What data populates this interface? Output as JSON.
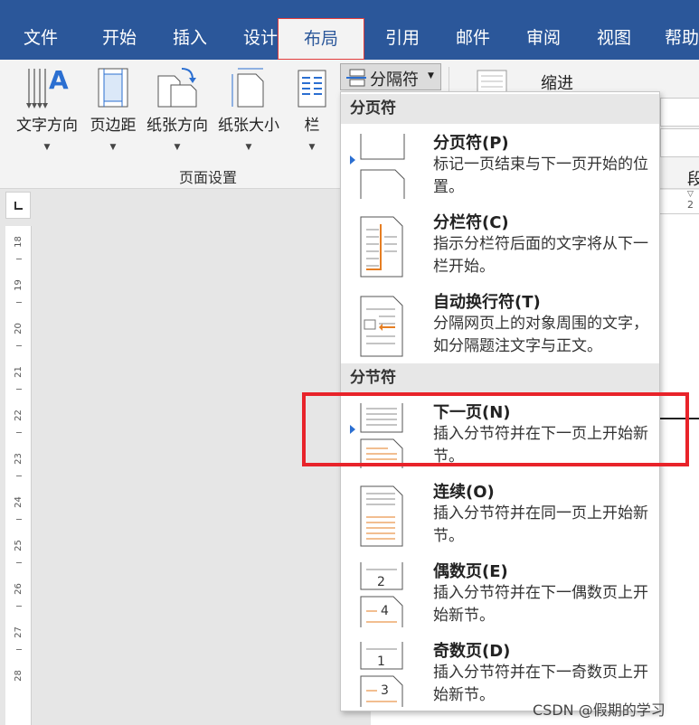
{
  "tabs": [
    "文件",
    "开始",
    "插入",
    "设计",
    "布局",
    "引用",
    "邮件",
    "审阅",
    "视图",
    "帮助"
  ],
  "active_tab_index": 4,
  "ribbon": {
    "buttons": [
      "文字方向",
      "页边距",
      "纸张方向",
      "纸张大小",
      "栏"
    ],
    "group_label": "页面设置",
    "breaks_button": "分隔符",
    "indent_label": "缩进",
    "right_label": "段"
  },
  "dropdown": {
    "page_breaks_header": "分页符",
    "section_breaks_header": "分节符",
    "items": [
      {
        "title": "分页符(P)",
        "desc": "标记一页结束与下一页开始的位置。"
      },
      {
        "title": "分栏符(C)",
        "desc": "指示分栏符后面的文字将从下一栏开始。"
      },
      {
        "title": "自动换行符(T)",
        "desc": "分隔网页上的对象周围的文字，如分隔题注文字与正文。"
      },
      {
        "title": "下一页(N)",
        "desc": "插入分节符并在下一页上开始新节。"
      },
      {
        "title": "连续(O)",
        "desc": "插入分节符并在同一页上开始新节。"
      },
      {
        "title": "偶数页(E)",
        "desc": "插入分节符并在下一偶数页上开始新节。"
      },
      {
        "title": "奇数页(D)",
        "desc": "插入分节符并在下一奇数页上开始新节。"
      }
    ]
  },
  "ruler_numbers": [
    "18",
    "19",
    "20",
    "21",
    "22",
    "23",
    "24",
    "25",
    "26",
    "27",
    "28"
  ],
  "hruler_number": "2",
  "watermark": "CSDN @假期的学习",
  "colors": {
    "accent": "#2b579a",
    "highlight": "#e8232a",
    "orange": "#e67e22"
  }
}
